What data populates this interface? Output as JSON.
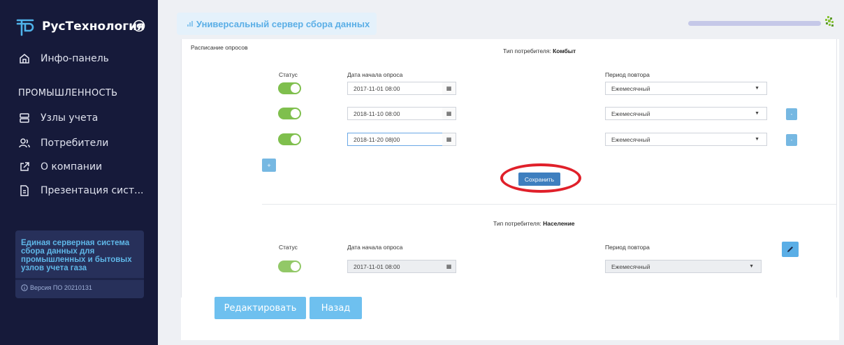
{
  "sidebar": {
    "brand": "РусТехнология",
    "nav": {
      "info_panel": "Инфо-панель",
      "section": "ПРОМЫШЛЕННОСТЬ",
      "meters": "Узлы учета",
      "consumers": "Потребители",
      "about": "О компании",
      "presentation": "Презентация сист..."
    },
    "info_card": {
      "text": "Единая серверная система сбора данных для промышленных и бытовых узлов учета газа",
      "version": "Версия ПО 20210131"
    }
  },
  "topbar": {
    "tab_title": "Универсальный сервер сбора данных"
  },
  "schedule": {
    "title": "Расписание опросов",
    "group1": {
      "consumer_type_label": "Тип потребителя:",
      "consumer_type_value": "Комбыт",
      "col_status": "Статус",
      "col_start": "Дата начала опроса",
      "col_period": "Период повтора",
      "rows": [
        {
          "date": "2017-11-01 08:00",
          "period": "Ежемесячный"
        },
        {
          "date": "2018-11-10 08:00",
          "period": "Ежемесячный"
        },
        {
          "date": "2018-11-20 08|00",
          "period": "Ежемесячный"
        }
      ],
      "add_label": "+",
      "remove_label": "-",
      "save_label": "Сохранить"
    },
    "group2": {
      "consumer_type_label": "Тип потребителя:",
      "consumer_type_value": "Население",
      "col_status": "Статус",
      "col_start": "Дата начала опроса",
      "col_period": "Период повтора",
      "rows": [
        {
          "date": "2017-11-01 08:00",
          "period": "Ежемесячный"
        }
      ]
    }
  },
  "actions": {
    "edit": "Редактировать",
    "back": "Назад"
  },
  "colors": {
    "sidebar_bg": "#161a3a",
    "accent": "#5aaee6",
    "toggle_on": "#7fbf4d",
    "save": "#3e7fbf",
    "highlight_ring": "#e0202a"
  }
}
